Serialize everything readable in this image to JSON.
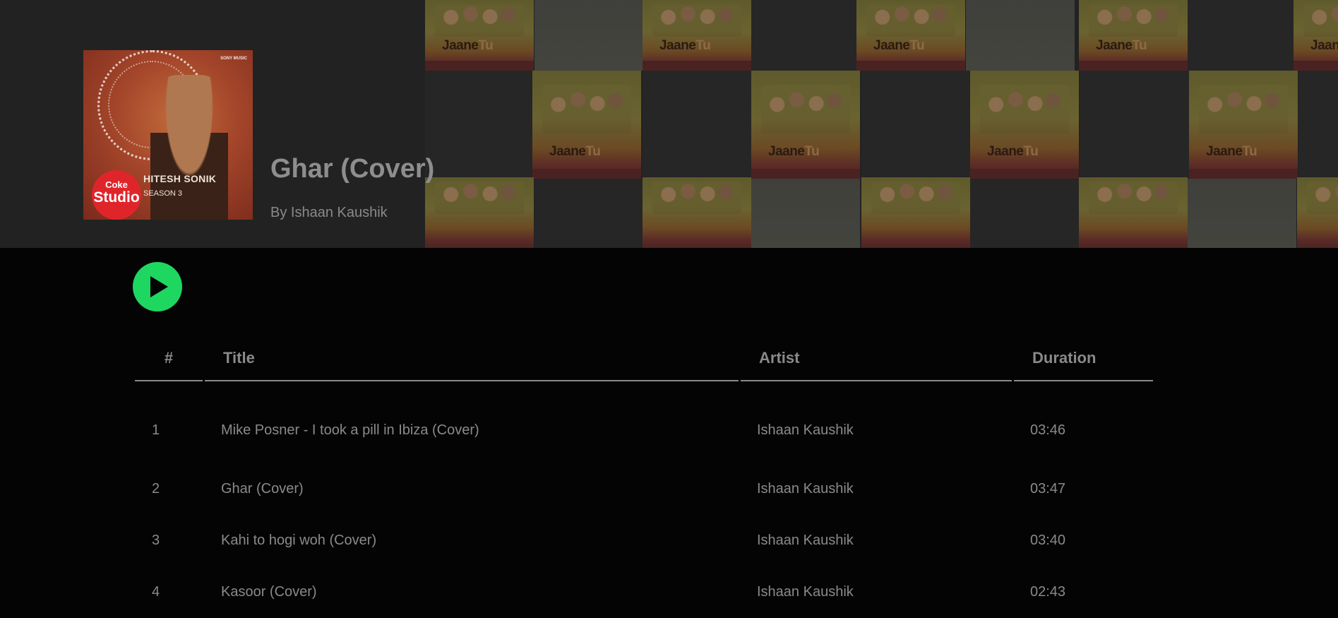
{
  "album": {
    "cover_art": {
      "brand": "SONY MUSIC",
      "badge_top": "Coke",
      "badge_bottom": "Studio",
      "artist": "HITESH SONIK",
      "season": "SEASON 3"
    },
    "title": "Ghar (Cover)",
    "owner": "By Ishaan Kaushik"
  },
  "background_collage": {
    "tile_text_a": "Jaane",
    "tile_text_b": "Tu"
  },
  "colors": {
    "header_bg": "#222222",
    "page_bg": "#040404",
    "play_accent": "#1ed760",
    "text_muted": "#8a8a8a"
  },
  "controls": {
    "play_icon": "play-icon"
  },
  "table": {
    "headers": {
      "num": "#",
      "title": "Title",
      "artist": "Artist",
      "duration": "Duration"
    },
    "rows": [
      {
        "num": "1",
        "title": "Mike Posner - I took a pill in Ibiza (Cover)",
        "artist": "Ishaan Kaushik",
        "duration": "03:46"
      },
      {
        "num": "2",
        "title": "Ghar (Cover)",
        "artist": "Ishaan Kaushik",
        "duration": "03:47"
      },
      {
        "num": "3",
        "title": "Kahi to hogi woh (Cover)",
        "artist": "Ishaan Kaushik",
        "duration": "03:40"
      },
      {
        "num": "4",
        "title": "Kasoor (Cover)",
        "artist": "Ishaan Kaushik",
        "duration": "02:43"
      }
    ]
  }
}
